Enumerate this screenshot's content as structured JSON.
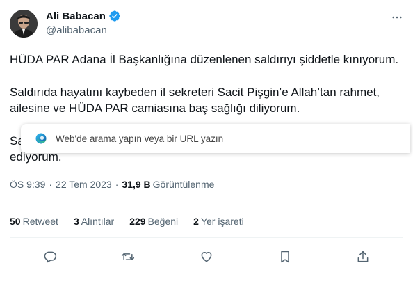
{
  "author": {
    "display_name": "Ali Babacan",
    "handle": "@alibabacan",
    "verified_color": "#1d9bf0"
  },
  "tweet": {
    "paragraphs": [
      "HÜDA PAR Adana İl Başkanlığına düzenlenen saldırıyı şiddetle kınıyorum.",
      "Saldırıda hayatını kaybeden il sekreteri Sacit Pişgin’e Allah’tan rahmet, ailesine ve HÜDA PAR camiasına baş sağlığı diliyorum.",
      "Sa                                                                                                                           ediyorum."
    ]
  },
  "meta": {
    "time": "ÖS 9:39",
    "date": "22 Tem 2023",
    "views_count": "31,9 B",
    "views_label": "Görüntülenme",
    "separator": "·"
  },
  "stats": [
    {
      "count": "50",
      "label": "Retweet"
    },
    {
      "count": "3",
      "label": "Alıntılar"
    },
    {
      "count": "229",
      "label": "Beğeni"
    },
    {
      "count": "2",
      "label": "Yer işareti"
    }
  ],
  "actions": [
    "reply-icon",
    "retweet-icon",
    "like-icon",
    "bookmark-icon",
    "share-icon"
  ],
  "browser_overlay": {
    "placeholder": "Web'de arama yapın veya bir URL yazın",
    "icon": "edge-icon"
  },
  "colors": {
    "text_primary": "#0f1419",
    "text_secondary": "#536471",
    "accent": "#1d9bf0",
    "divider": "#eff3f4"
  }
}
